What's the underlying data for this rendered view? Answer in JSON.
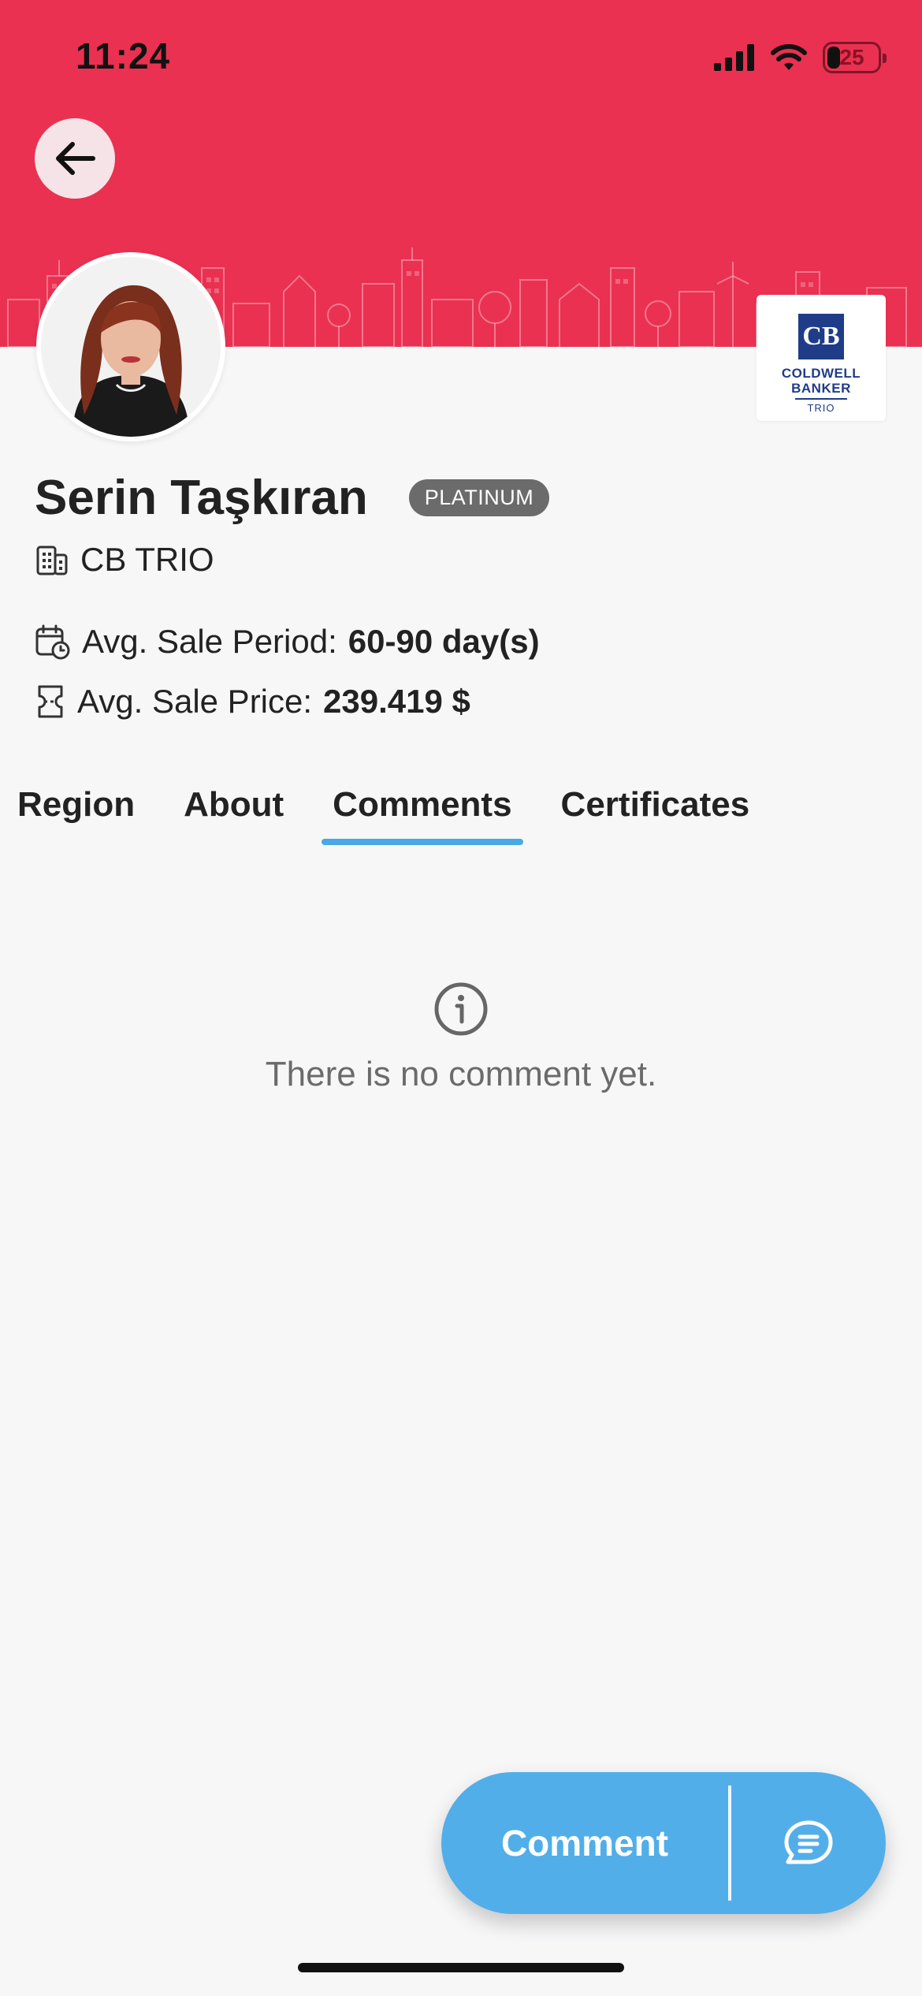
{
  "status_bar": {
    "time": "11:24",
    "battery_level": "25",
    "battery_fraction": 0.25
  },
  "colors": {
    "header": "#ea3151",
    "accent": "#4aa8e6",
    "button": "#52aee9",
    "badge": "#6b6b6b"
  },
  "header": {
    "back_icon": "arrow-left-icon"
  },
  "agent": {
    "name": "Serin Taşkıran",
    "level_badge": "PLATINUM",
    "office": "CB TRIO",
    "avg_sale_period_label": "Avg. Sale Period:",
    "avg_sale_period_value": "60-90 day(s)",
    "avg_sale_price_label": "Avg. Sale Price:",
    "avg_sale_price_value": "239.419 $"
  },
  "brand": {
    "mark": "CB",
    "line1": "COLDWELL",
    "line2": "BANKER",
    "sub": "TRIO"
  },
  "tabs": [
    {
      "label": "Region",
      "active": false
    },
    {
      "label": "About",
      "active": false
    },
    {
      "label": "Comments",
      "active": true
    },
    {
      "label": "Certificates",
      "active": false
    }
  ],
  "comments": {
    "empty_icon": "info-icon",
    "empty_message": "There is no comment yet."
  },
  "action": {
    "label": "Comment",
    "icon": "comment-bubble-icon"
  }
}
